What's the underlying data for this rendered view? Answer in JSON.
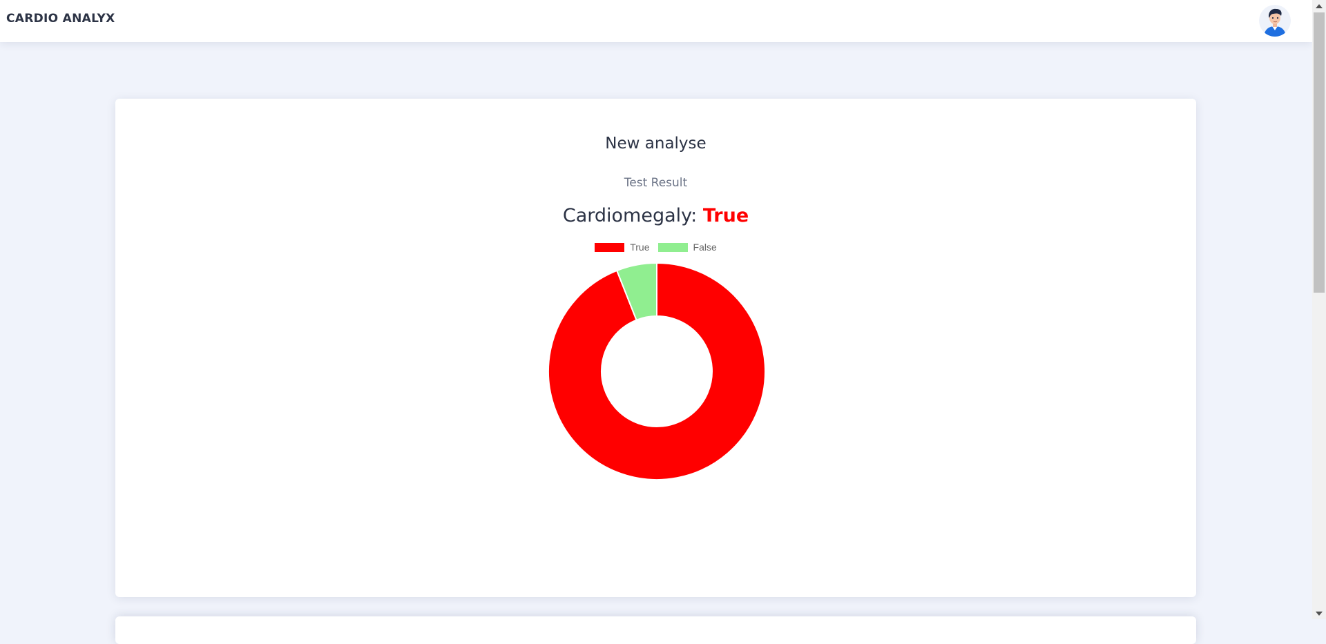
{
  "header": {
    "brand": "CARDIO ANALYX",
    "avatar_icon": "user-avatar-icon"
  },
  "card": {
    "title": "New analyse",
    "subtitle": "Test Result",
    "result_label": "Cardiomegaly:",
    "result_value": "True",
    "result_color": "#ff0000"
  },
  "chart_data": {
    "type": "pie",
    "variant": "doughnut",
    "labels": [
      "True",
      "False"
    ],
    "values": [
      94,
      6
    ],
    "colors": [
      "#ff0000",
      "#90ee90"
    ],
    "legend_position": "top"
  }
}
